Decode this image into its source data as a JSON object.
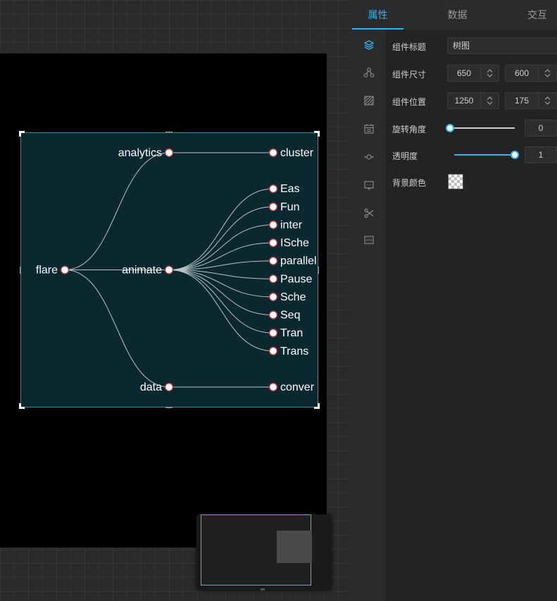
{
  "tabs": [
    {
      "label": "属性",
      "active": true
    },
    {
      "label": "数据",
      "active": false
    },
    {
      "label": "交互",
      "active": false
    }
  ],
  "rail_icons": [
    "layers-icon",
    "nodes-icon",
    "texture-icon",
    "calendar-icon",
    "connector-icon",
    "comment-icon",
    "scissors-icon",
    "code-icon"
  ],
  "properties": {
    "title_label": "组件标题",
    "title_value": "树图",
    "size_label": "组件尺寸",
    "width": "650",
    "height": "600",
    "position_label": "组件位置",
    "pos_x": "1250",
    "pos_y": "175",
    "rotation_label": "旋转角度",
    "rotation_value": "0",
    "rotation_fraction": 0,
    "opacity_label": "透明度",
    "opacity_value": "1",
    "opacity_fraction": 1,
    "bg_color_label": "背景颜色"
  },
  "chart_data": {
    "type": "tree",
    "root": {
      "name": "flare",
      "children": [
        {
          "name": "analytics",
          "children": [
            {
              "name": "cluster"
            }
          ]
        },
        {
          "name": "animate",
          "children": [
            {
              "name": "Eas"
            },
            {
              "name": "Fun"
            },
            {
              "name": "inter"
            },
            {
              "name": "ISche"
            },
            {
              "name": "parallel"
            },
            {
              "name": "Pause"
            },
            {
              "name": "Sche"
            },
            {
              "name": "Seq"
            },
            {
              "name": "Tran"
            },
            {
              "name": "Trans"
            }
          ]
        },
        {
          "name": "data",
          "children": [
            {
              "name": "conver"
            }
          ]
        }
      ]
    },
    "colors": {
      "background": "#0b2830",
      "link": "#b8c4c8",
      "node_fill": "#ffffff",
      "node_stroke": "#b0333a",
      "label": "#ffffff"
    }
  }
}
